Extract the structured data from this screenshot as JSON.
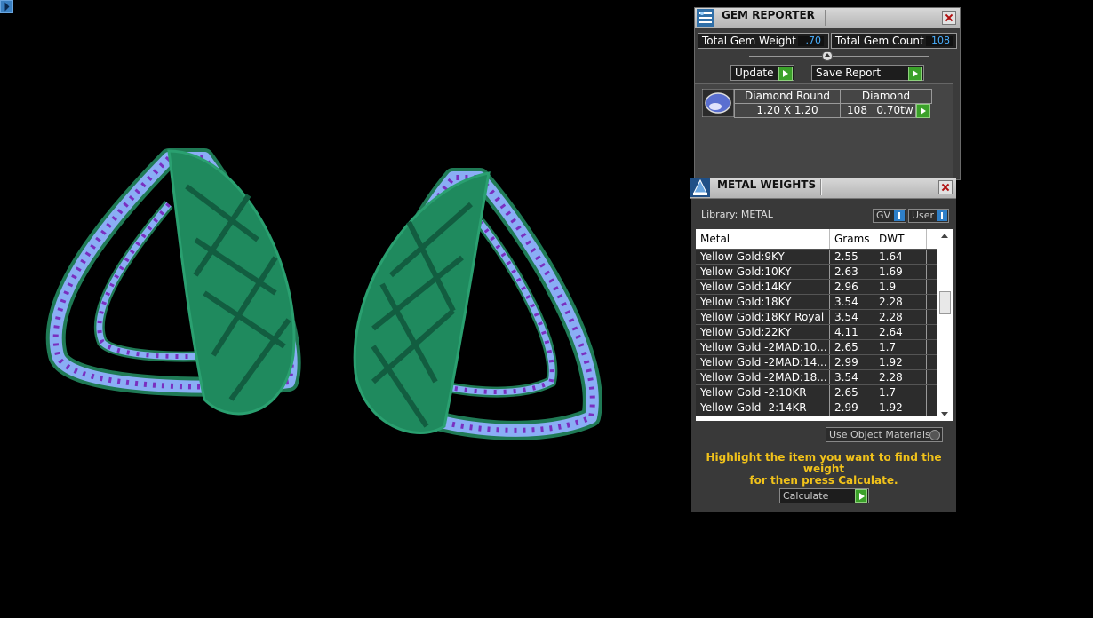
{
  "gem_reporter": {
    "title": "GEM REPORTER",
    "total_gem_weight_label": "Total Gem Weight",
    "total_gem_weight_value": ".70",
    "total_gem_count_label": "Total Gem Count",
    "total_gem_count_value": "108",
    "update_label": "Update",
    "save_report_label": "Save Report",
    "gem": {
      "shape": "Diamond Round",
      "type": "Diamond",
      "size": "1.20 X 1.20",
      "count": "108",
      "weight": "0.70tw"
    }
  },
  "metal_weights": {
    "title": "METAL WEIGHTS",
    "library_label": "Library: METAL",
    "gv_label": "GV",
    "user_label": "User",
    "columns": [
      "Metal",
      "Grams",
      "DWT"
    ],
    "rows": [
      {
        "metal": "Yellow Gold:9KY",
        "grams": "2.55",
        "dwt": "1.64"
      },
      {
        "metal": "Yellow Gold:10KY",
        "grams": "2.63",
        "dwt": "1.69"
      },
      {
        "metal": "Yellow Gold:14KY",
        "grams": "2.96",
        "dwt": "1.9"
      },
      {
        "metal": "Yellow Gold:18KY",
        "grams": "3.54",
        "dwt": "2.28"
      },
      {
        "metal": "Yellow Gold:18KY Royal",
        "grams": "3.54",
        "dwt": "2.28"
      },
      {
        "metal": "Yellow Gold:22KY",
        "grams": "4.11",
        "dwt": "2.64"
      },
      {
        "metal": "Yellow Gold -2MAD:10...",
        "grams": "2.65",
        "dwt": "1.7"
      },
      {
        "metal": "Yellow Gold -2MAD:14...",
        "grams": "2.99",
        "dwt": "1.92"
      },
      {
        "metal": "Yellow Gold -2MAD:18...",
        "grams": "3.54",
        "dwt": "2.28"
      },
      {
        "metal": "Yellow Gold -2:10KR",
        "grams": "2.65",
        "dwt": "1.7"
      },
      {
        "metal": "Yellow Gold -2:14KR",
        "grams": "2.99",
        "dwt": "1.92"
      }
    ],
    "use_object_materials_label": "Use Object Materials",
    "hint_line1": "Highlight the item you want to find the weight",
    "hint_line2": "for then press Calculate.",
    "calculate_label": "Calculate"
  },
  "colors": {
    "metal_green": "#1f8a5e",
    "gem_blue": "#8aaef5",
    "gem_purple": "#7a2fc0",
    "hint_yellow": "#f1c21a",
    "value_blue": "#4ab0ff",
    "play_green": "#3ba12a"
  }
}
